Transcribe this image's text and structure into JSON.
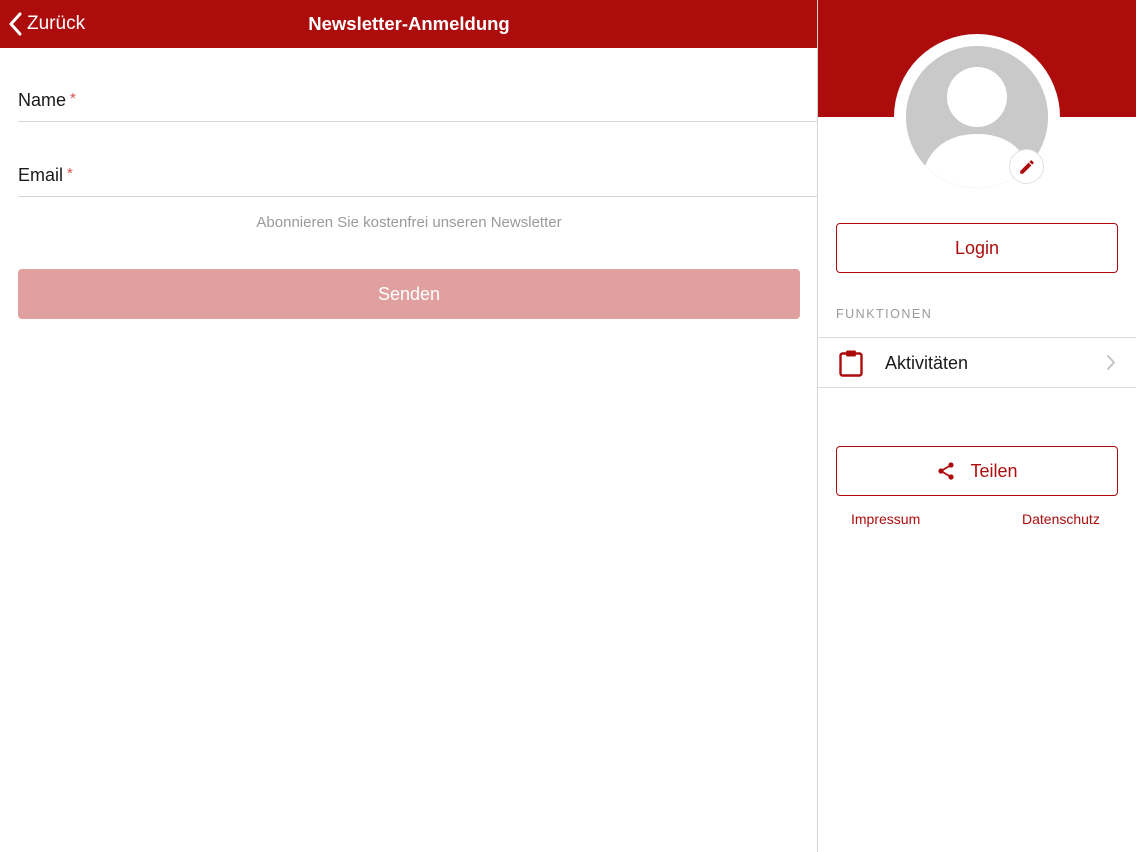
{
  "theme": {
    "brand_red": "#ad0c0c",
    "disabled_button": "#e0a0a0",
    "hint_gray": "#9a9a9a"
  },
  "navbar": {
    "back_label": "Zurück",
    "back_icon": "chevron-left-icon",
    "title": "Newsletter-Anmeldung"
  },
  "form": {
    "name": {
      "label": "Name",
      "required_marker": "*",
      "value": ""
    },
    "email": {
      "label": "Email",
      "required_marker": "*",
      "value": ""
    },
    "hint": "Abonnieren Sie kostenfrei unseren Newsletter",
    "submit_label": "Senden",
    "submit_enabled": false
  },
  "side_panel": {
    "avatar_icon": "user-placeholder-icon",
    "edit_icon": "pencil-icon",
    "login_label": "Login",
    "section_title": "FUNKTIONEN",
    "menu_items": [
      {
        "label": "Aktivitäten",
        "icon": "clipboard-icon"
      }
    ],
    "share_label": "Teilen",
    "share_icon": "share-icon",
    "footer_links": [
      "Impressum",
      "Datenschutz"
    ]
  }
}
